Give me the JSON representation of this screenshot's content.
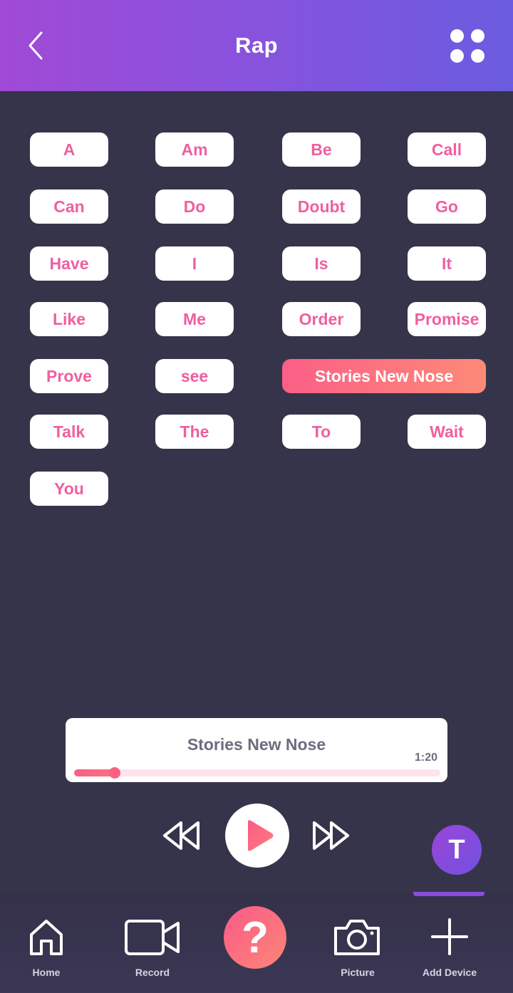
{
  "header": {
    "title": "Rap",
    "back_icon": "chevron-left-icon",
    "menu_icon": "grid-dots-icon"
  },
  "words": [
    {
      "label": "A"
    },
    {
      "label": "Am"
    },
    {
      "label": "Be"
    },
    {
      "label": "Call"
    },
    {
      "label": "Can"
    },
    {
      "label": "Do"
    },
    {
      "label": "Doubt"
    },
    {
      "label": "Go"
    },
    {
      "label": "Have"
    },
    {
      "label": "I"
    },
    {
      "label": "Is"
    },
    {
      "label": "It"
    },
    {
      "label": "Like"
    },
    {
      "label": "Me"
    },
    {
      "label": "Order"
    },
    {
      "label": "Promise"
    },
    {
      "label": "Prove"
    },
    {
      "label": "see"
    },
    {
      "label": "Stories New Nose",
      "selected": true
    },
    {
      "label": "Talk"
    },
    {
      "label": "The"
    },
    {
      "label": "To"
    },
    {
      "label": "Wait"
    },
    {
      "label": "You"
    }
  ],
  "player": {
    "title": "Stories New Nose",
    "time": "1:20",
    "progress": 0.11
  },
  "controls": {
    "rewind_icon": "rewind-icon",
    "play_icon": "play-icon",
    "forward_icon": "fast-forward-icon"
  },
  "avatar": {
    "initial": "T"
  },
  "nav": {
    "home": "Home",
    "record": "Record",
    "help": "?",
    "picture": "Picture",
    "add_device": "Add Device"
  },
  "colors": {
    "accent": "#fb5f86",
    "chip_text": "#ef5fa0",
    "background": "#36344a",
    "header_start": "#a04ad6",
    "header_end": "#6a5ce0"
  }
}
